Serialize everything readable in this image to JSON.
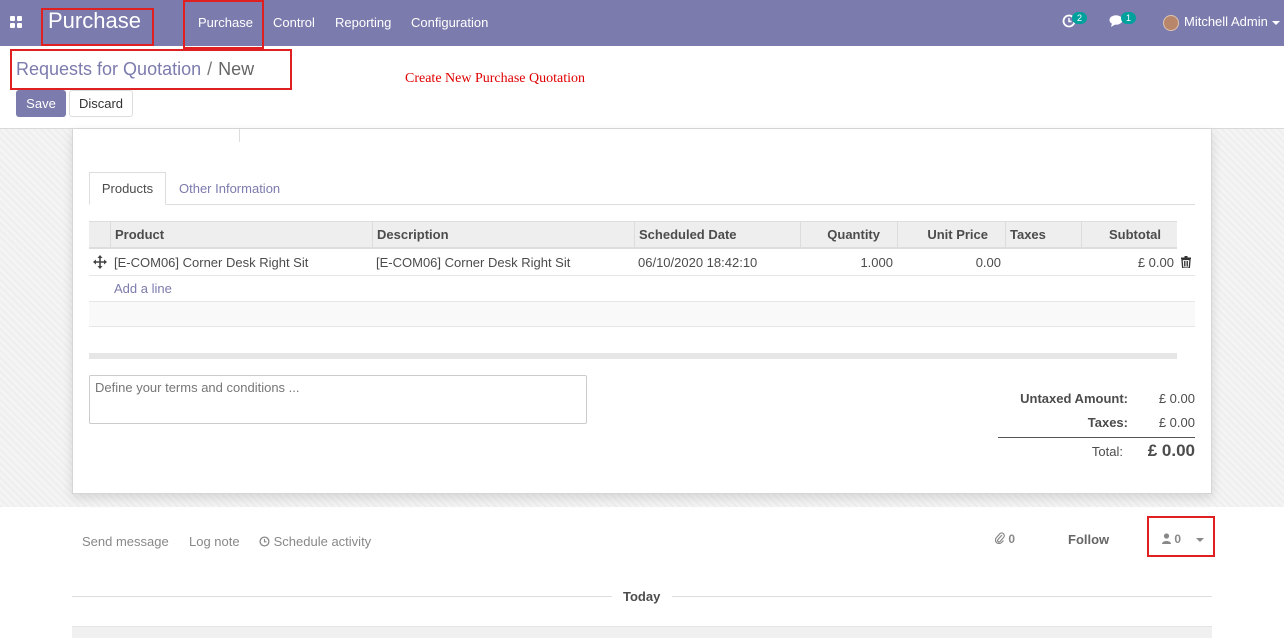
{
  "navbar": {
    "app_name": "Purchase",
    "menu": [
      "Purchase",
      "Control",
      "Reporting",
      "Configuration"
    ],
    "activity_count": "2",
    "message_count": "1",
    "user_name": "Mitchell Admin"
  },
  "control_panel": {
    "breadcrumb_parent": "Requests for Quotation",
    "breadcrumb_sep": "/",
    "breadcrumb_current": "New",
    "annotation": "Create New Purchase Quotation",
    "save_label": "Save",
    "discard_label": "Discard"
  },
  "tabs": [
    "Products",
    "Other Information"
  ],
  "order_lines": {
    "headers": [
      "Product",
      "Description",
      "Scheduled Date",
      "Quantity",
      "Unit Price",
      "Taxes",
      "Subtotal"
    ],
    "rows": [
      {
        "product": "[E-COM06] Corner Desk Right Sit",
        "description": "[E-COM06] Corner Desk Right Sit",
        "scheduled_date": "06/10/2020 18:42:10",
        "quantity": "1.000",
        "unit_price": "0.00",
        "taxes": "",
        "subtotal": "£ 0.00"
      }
    ],
    "add_line": "Add a line"
  },
  "notes_placeholder": "Define your terms and conditions ...",
  "totals": {
    "untaxed_label": "Untaxed Amount:",
    "untaxed_value": "£ 0.00",
    "taxes_label": "Taxes:",
    "taxes_value": "£ 0.00",
    "total_label": "Total:",
    "total_value": "£ 0.00"
  },
  "chatter": {
    "send_message": "Send message",
    "log_note": "Log note",
    "schedule_activity": "Schedule activity",
    "attachments_count": "0",
    "follow_label": "Follow",
    "followers_count": "0",
    "today_label": "Today"
  },
  "colors": {
    "brand": "#7c7bad",
    "badge": "#00a09d",
    "highlight": "#e02020"
  }
}
